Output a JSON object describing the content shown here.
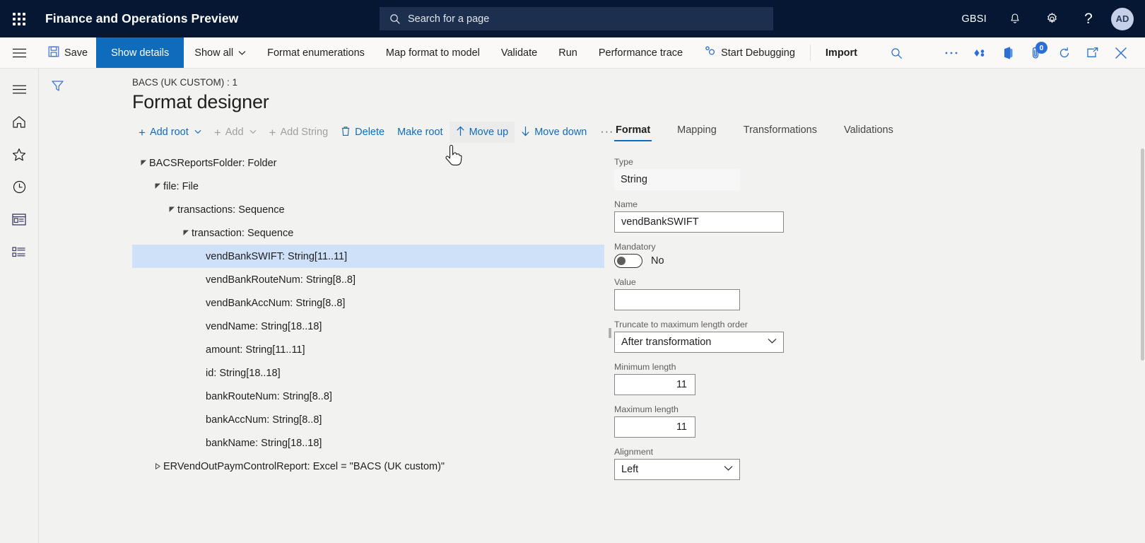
{
  "topnav": {
    "waffle_icon": "app-launcher-icon",
    "app_title": "Finance and Operations Preview",
    "search": {
      "icon": "search-icon",
      "placeholder": "Search for a page",
      "value": ""
    },
    "company": "GBSI",
    "notifications_icon": "bell-icon",
    "settings_icon": "gear-icon",
    "help_icon": "question-mark-icon",
    "avatar_initials": "AD",
    "bg_color": "#061733",
    "search_bg_color": "#1d2f4e"
  },
  "commandbar": {
    "menu_icon": "hamburger-menu-icon",
    "save_label": "Save",
    "save_icon": "save-disk-icon",
    "show_details_label": "Show details",
    "show_all_label": "Show all",
    "show_all_chevron": "chevron-down-icon",
    "format_enumerations_label": "Format enumerations",
    "map_format_to_model_label": "Map format to model",
    "validate_label": "Validate",
    "run_label": "Run",
    "performance_trace_label": "Performance trace",
    "start_debugging_label": "Start Debugging",
    "start_debugging_icon": "debug-gear-icon",
    "import_label": "Import",
    "search_icon": "search-icon",
    "overflow_icon": "ellipsis-icon",
    "share_icon": "share-diamond-icon",
    "office_icon": "office-app-icon",
    "attachments_icon": "attachment-icon",
    "attachments_count": "0",
    "refresh_icon": "refresh-icon",
    "popout_icon": "open-in-new-window-icon",
    "close_icon": "close-x-icon",
    "primary_color": "#0f6cbd",
    "badge_color": "#2b6fd4"
  },
  "leftrail": {
    "items": [
      {
        "icon": "hamburger-menu-icon",
        "name": "nav-expand"
      },
      {
        "icon": "home-icon",
        "name": "home"
      },
      {
        "icon": "star-icon",
        "name": "favorites"
      },
      {
        "icon": "clock-icon",
        "name": "recent"
      },
      {
        "icon": "workspace-icon",
        "name": "workspaces"
      },
      {
        "icon": "modules-list-icon",
        "name": "modules"
      }
    ]
  },
  "page": {
    "filter_icon": "filter-funnel-icon",
    "breadcrumb": "BACS (UK CUSTOM) : 1",
    "title": "Format designer"
  },
  "tree_toolbar": {
    "add_root_label": "Add root",
    "add_root_chevron": "chevron-down-icon",
    "add_label": "Add",
    "add_chevron": "chevron-down-icon",
    "add_string_label": "Add String",
    "delete_label": "Delete",
    "delete_icon": "trash-can-icon",
    "make_root_label": "Make root",
    "move_up_label": "Move up",
    "move_up_icon": "arrow-up-icon",
    "move_down_label": "Move down",
    "move_down_icon": "arrow-down-icon",
    "overflow_label": "···"
  },
  "tree": {
    "nodes": [
      {
        "label": "BACSReportsFolder: Folder",
        "indent": 0,
        "caret": "expanded",
        "selected": false
      },
      {
        "label": "file: File",
        "indent": 1,
        "caret": "expanded",
        "selected": false
      },
      {
        "label": "transactions: Sequence",
        "indent": 2,
        "caret": "expanded",
        "selected": false
      },
      {
        "label": "transaction: Sequence",
        "indent": 3,
        "caret": "expanded",
        "selected": false
      },
      {
        "label": "vendBankSWIFT: String[11..11]",
        "indent": 4,
        "caret": "none",
        "selected": true
      },
      {
        "label": "vendBankRouteNum: String[8..8]",
        "indent": 4,
        "caret": "none",
        "selected": false
      },
      {
        "label": "vendBankAccNum: String[8..8]",
        "indent": 4,
        "caret": "none",
        "selected": false
      },
      {
        "label": "vendName: String[18..18]",
        "indent": 4,
        "caret": "none",
        "selected": false
      },
      {
        "label": "amount: String[11..11]",
        "indent": 4,
        "caret": "none",
        "selected": false
      },
      {
        "label": "id: String[18..18]",
        "indent": 4,
        "caret": "none",
        "selected": false
      },
      {
        "label": "bankRouteNum: String[8..8]",
        "indent": 4,
        "caret": "none",
        "selected": false
      },
      {
        "label": "bankAccNum: String[8..8]",
        "indent": 4,
        "caret": "none",
        "selected": false
      },
      {
        "label": "bankName: String[18..18]",
        "indent": 4,
        "caret": "none",
        "selected": false
      },
      {
        "label": "ERVendOutPaymControlReport: Excel = \"BACS (UK custom)\"",
        "indent": 1,
        "caret": "collapsed",
        "selected": false
      }
    ],
    "selected_bg_color": "#cfe0f9"
  },
  "properties": {
    "tabs": [
      {
        "label": "Format",
        "active": true
      },
      {
        "label": "Mapping",
        "active": false
      },
      {
        "label": "Transformations",
        "active": false
      },
      {
        "label": "Validations",
        "active": false
      }
    ],
    "fields": {
      "type_label": "Type",
      "type_value": "String",
      "name_label": "Name",
      "name_value": "vendBankSWIFT",
      "mandatory_label": "Mandatory",
      "mandatory_value": "No",
      "value_label": "Value",
      "value_value": "",
      "truncate_label": "Truncate to maximum length order",
      "truncate_value": "After transformation",
      "min_length_label": "Minimum length",
      "min_length_value": "11",
      "max_length_label": "Maximum length",
      "max_length_value": "11",
      "alignment_label": "Alignment",
      "alignment_value": "Left"
    }
  }
}
